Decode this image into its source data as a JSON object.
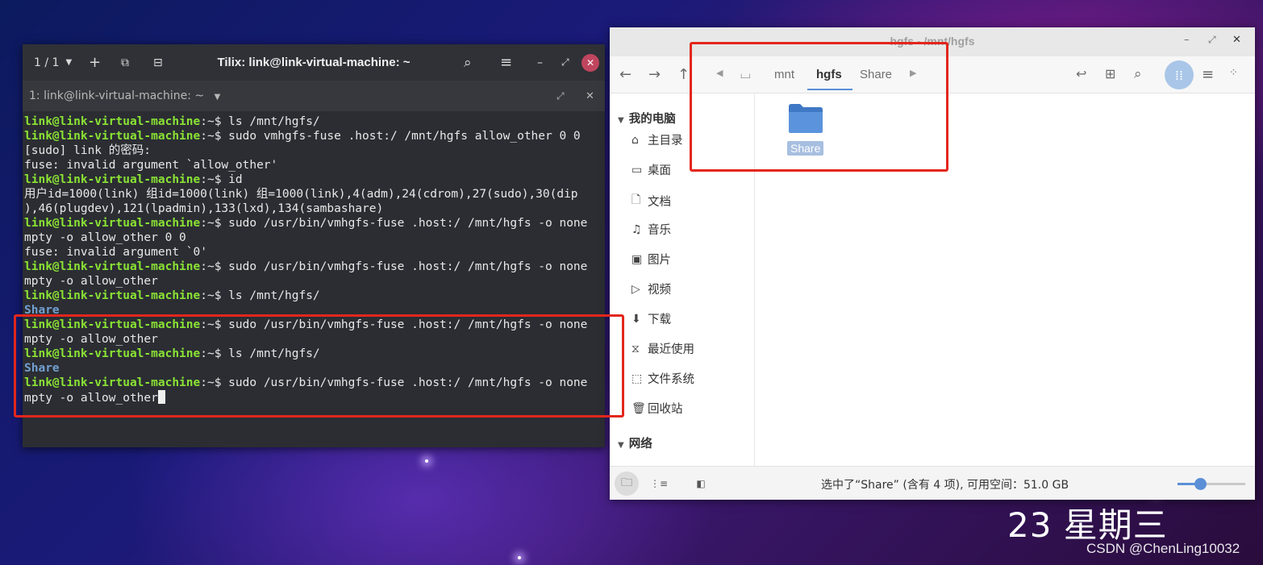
{
  "terminal": {
    "session_counter": "1 / 1",
    "title": "Tilix: link@link-virtual-machine: ~",
    "tab_label": "1: link@link-virtual-machine: ~",
    "lines": [
      {
        "user": "link@link-virtual-machine",
        "rest": ":~$ ls /mnt/hgfs/"
      },
      {
        "user": "link@link-virtual-machine",
        "rest": ":~$ sudo vmhgfs-fuse .host:/ /mnt/hgfs allow_other 0 0"
      },
      {
        "text": "[sudo] link 的密码:"
      },
      {
        "text": "fuse: invalid argument `allow_other'"
      },
      {
        "user": "link@link-virtual-machine",
        "rest": ":~$ id"
      },
      {
        "text": "用户id=1000(link) 组id=1000(link) 组=1000(link),4(adm),24(cdrom),27(sudo),30(dip"
      },
      {
        "text": "),46(plugdev),121(lpadmin),133(lxd),134(sambashare)"
      },
      {
        "user": "link@link-virtual-machine",
        "rest": ":~$ sudo /usr/bin/vmhgfs-fuse .host:/ /mnt/hgfs -o none"
      },
      {
        "text": "mpty -o allow_other 0 0"
      },
      {
        "text": "fuse: invalid argument `0'"
      },
      {
        "user": "link@link-virtual-machine",
        "rest": ":~$ sudo /usr/bin/vmhgfs-fuse .host:/ /mnt/hgfs -o none"
      },
      {
        "text": "mpty -o allow_other"
      },
      {
        "user": "link@link-virtual-machine",
        "rest": ":~$ ls /mnt/hgfs/"
      },
      {
        "share": "Share"
      },
      {
        "user": "link@link-virtual-machine",
        "rest": ":~$ sudo /usr/bin/vmhgfs-fuse .host:/ /mnt/hgfs -o none"
      },
      {
        "text": "mpty -o allow_other"
      },
      {
        "user": "link@link-virtual-machine",
        "rest": ":~$ ls /mnt/hgfs/"
      },
      {
        "share": "Share"
      },
      {
        "user": "link@link-virtual-machine",
        "rest": ":~$ sudo /usr/bin/vmhgfs-fuse .host:/ /mnt/hgfs -o none"
      },
      {
        "text": "mpty -o allow_other",
        "cursor": true
      }
    ]
  },
  "file_manager": {
    "title": "hgfs - /mnt/hgfs",
    "breadcrumbs": [
      "mnt",
      "hgfs",
      "Share"
    ],
    "active_crumb": "hgfs",
    "sidebar": {
      "section_computer": "我的电脑",
      "items": [
        {
          "icon": "home-icon",
          "glyph": "⌂",
          "label": "主目录"
        },
        {
          "icon": "desktop-icon",
          "glyph": "▭",
          "label": "桌面"
        },
        {
          "icon": "documents-icon",
          "glyph": "🗋",
          "label": "文档"
        },
        {
          "icon": "music-icon",
          "glyph": "♫",
          "label": "音乐"
        },
        {
          "icon": "pictures-icon",
          "glyph": "▣",
          "label": "图片"
        },
        {
          "icon": "videos-icon",
          "glyph": "▷",
          "label": "视频"
        },
        {
          "icon": "downloads-icon",
          "glyph": "⬇",
          "label": "下载"
        },
        {
          "icon": "recent-icon",
          "glyph": "⧖",
          "label": "最近使用"
        },
        {
          "icon": "filesystem-icon",
          "glyph": "⬚",
          "label": "文件系统"
        },
        {
          "icon": "trash-icon",
          "glyph": "🗑",
          "label": "回收站"
        }
      ],
      "section_network": "网络"
    },
    "folder": {
      "name": "Share"
    },
    "status": "选中了“Share” (含有 4 项), 可用空间：51.0 GB",
    "zoom_fraction": 0.33
  },
  "desktop": {
    "clock": "23 星期三",
    "watermark": "CSDN @ChenLing10032"
  },
  "colors": {
    "annotation_red": "#e3261c",
    "terminal_user_green": "#8ae234",
    "folder_blue": "#4a86d4"
  }
}
